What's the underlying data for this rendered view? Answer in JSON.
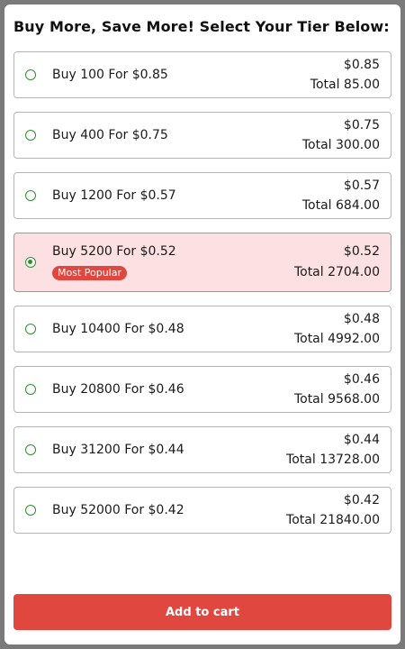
{
  "title": "Buy More, Save More! Select Your Tier Below:",
  "tiers": [
    {
      "label": "Buy 100 For $0.85",
      "price": "$0.85",
      "total": "Total 85.00",
      "selected": false
    },
    {
      "label": "Buy 400 For $0.75",
      "price": "$0.75",
      "total": "Total 300.00",
      "selected": false
    },
    {
      "label": "Buy 1200 For $0.57",
      "price": "$0.57",
      "total": "Total 684.00",
      "selected": false
    },
    {
      "label": "Buy 5200 For $0.52",
      "price": "$0.52",
      "total": "Total 2704.00",
      "selected": true,
      "badge": "Most Popular"
    },
    {
      "label": "Buy 10400 For $0.48",
      "price": "$0.48",
      "total": "Total 4992.00",
      "selected": false
    },
    {
      "label": "Buy 20800 For $0.46",
      "price": "$0.46",
      "total": "Total 9568.00",
      "selected": false
    },
    {
      "label": "Buy 31200 For $0.44",
      "price": "$0.44",
      "total": "Total 13728.00",
      "selected": false
    },
    {
      "label": "Buy 52000 For $0.42",
      "price": "$0.42",
      "total": "Total 21840.00",
      "selected": false
    }
  ],
  "cart_button": "Add to cart",
  "colors": {
    "accent": "#e0473e",
    "selected_bg": "#fde1e2",
    "radio": "#2f8f2f"
  }
}
